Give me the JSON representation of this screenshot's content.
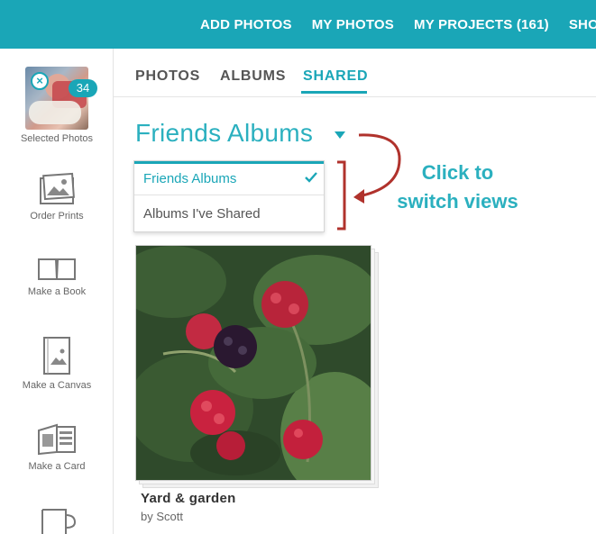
{
  "top_nav": {
    "items": [
      "ADD PHOTOS",
      "MY PHOTOS",
      "MY PROJECTS (161)",
      "SHOP"
    ],
    "active": "MY PHOTOS"
  },
  "sidebar": {
    "selected_photos": {
      "label": "Selected Photos",
      "count": "34",
      "remove_glyph": "×"
    },
    "items": [
      {
        "label": "Order Prints",
        "icon": "photo-print-icon"
      },
      {
        "label": "Make a Book",
        "icon": "book-icon"
      },
      {
        "label": "Make a Canvas",
        "icon": "canvas-icon"
      },
      {
        "label": "Make a Card",
        "icon": "card-icon"
      },
      {
        "label": "",
        "icon": "mug-icon"
      }
    ]
  },
  "sub_nav": {
    "tabs": [
      "PHOTOS",
      "ALBUMS",
      "SHARED"
    ],
    "active": "SHARED"
  },
  "view_selector": {
    "title": "Friends Albums",
    "options": [
      "Friends Albums",
      "Albums I've Shared"
    ],
    "selected": "Friends Albums"
  },
  "annotation": {
    "line1": "Click to",
    "line2": "switch views"
  },
  "album": {
    "title": "Yard & garden",
    "owner": "by Scott"
  },
  "colors": {
    "accent": "#1aa6b7",
    "title": "#2bb0bf",
    "annotation_bracket": "#b0322c"
  }
}
